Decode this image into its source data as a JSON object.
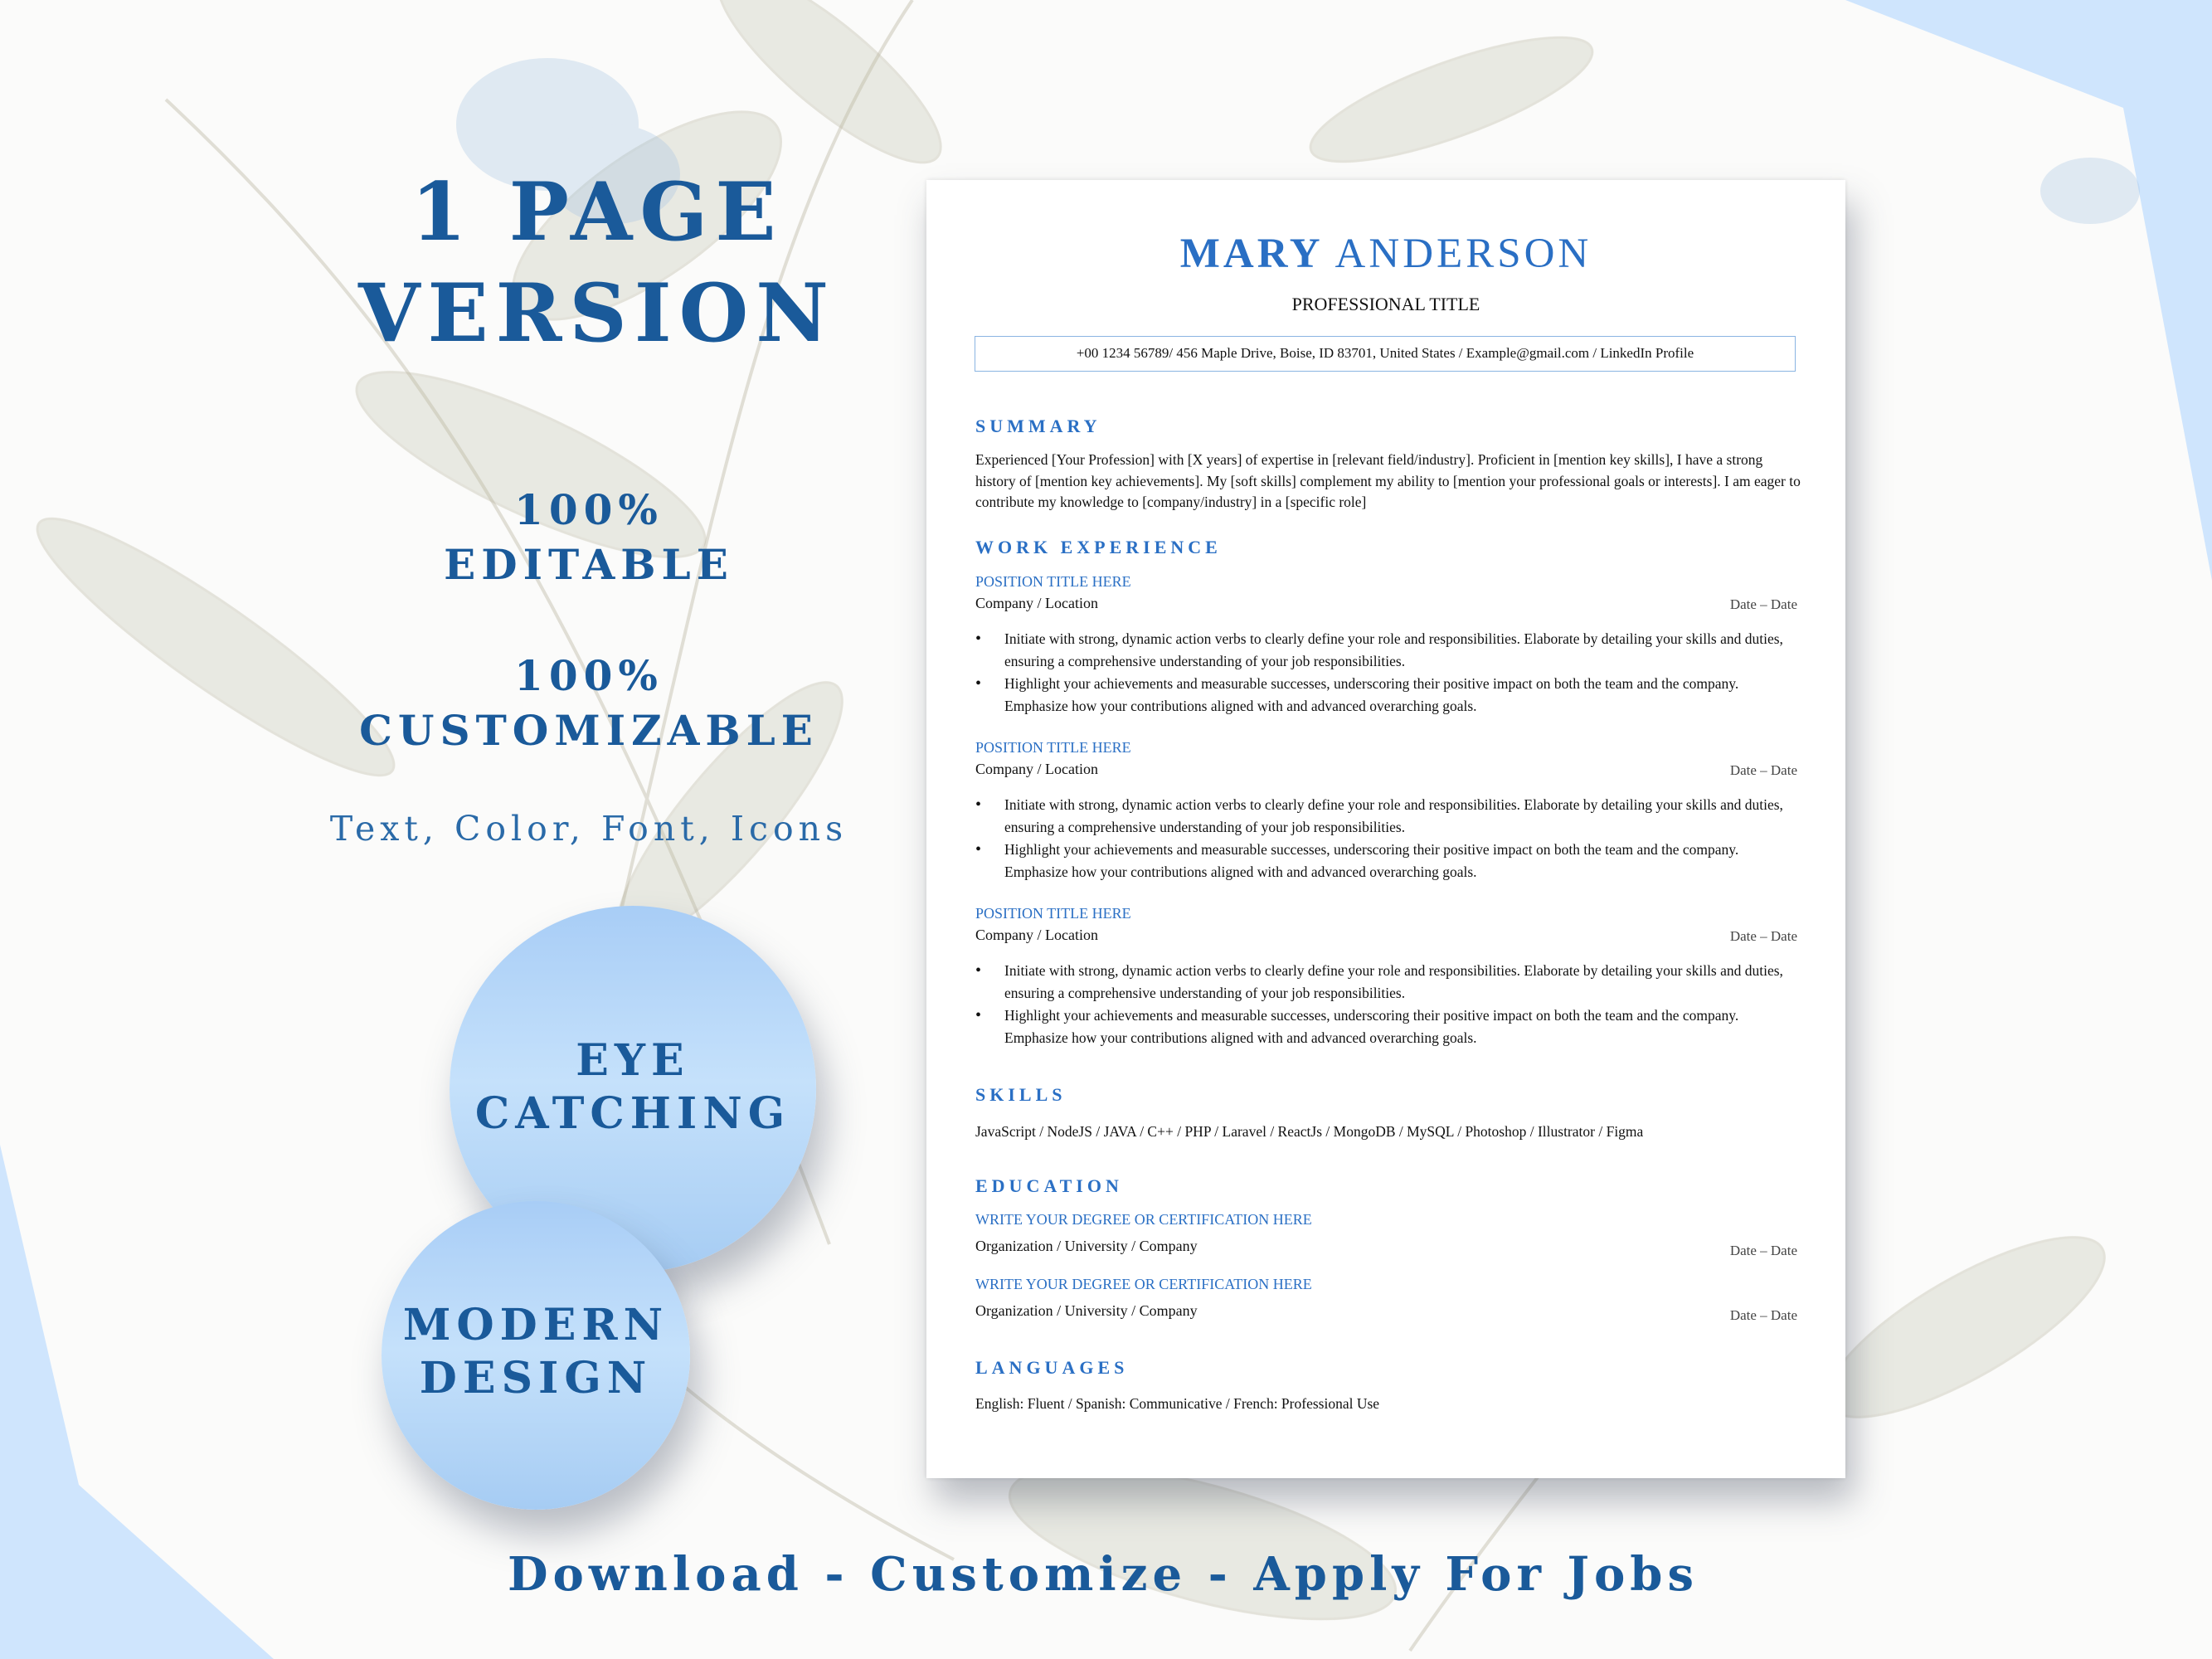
{
  "promo": {
    "heading_line1": "1 PAGE",
    "heading_line2": "VERSION",
    "feature1_line1": "100%",
    "feature1_line2": "EDITABLE",
    "feature2_line1": "100%",
    "feature2_line2": "CUSTOMIZABLE",
    "subtext": "Text, Color, Font, Icons",
    "circle1_line1": "EYE",
    "circle1_line2": "CATCHING",
    "circle2_line1": "MODERN",
    "circle2_line2": "DESIGN",
    "tagline": "Download - Customize - Apply For Jobs"
  },
  "colors": {
    "accent": "#2a6fc4",
    "promo_text": "#1a5a9a",
    "circle_fill": "#b8d8f8",
    "corner_blue": "#cfe5fd"
  },
  "resume": {
    "first_name": "MARY",
    "last_name": "ANDERSON",
    "title": "PROFESSIONAL TITLE",
    "contact": "+00 1234 56789/ 456 Maple Drive, Boise, ID 83701, United States / Example@gmail.com / LinkedIn Profile",
    "summary_heading": "SUMMARY",
    "summary_text": "Experienced [Your Profession] with [X years] of expertise in [relevant field/industry]. Proficient in [mention key skills], I have a strong history of [mention key achievements]. My [soft skills] complement my ability to [mention your professional goals or interests]. I am eager to contribute my knowledge to [company/industry] in a [specific role]",
    "work_heading": "WORK EXPERIENCE",
    "jobs": [
      {
        "position": "POSITION TITLE HERE",
        "company": "Company / Location",
        "date": "Date – Date",
        "bullets": [
          "Initiate with strong, dynamic action verbs to clearly define your role and responsibilities. Elaborate by detailing your skills and duties, ensuring a comprehensive understanding of your job responsibilities.",
          "Highlight your achievements and measurable successes, underscoring their positive impact on both the team and the company. Emphasize how your contributions aligned with and advanced overarching goals."
        ]
      },
      {
        "position": "POSITION TITLE HERE",
        "company": "Company / Location",
        "date": "Date – Date",
        "bullets": [
          "Initiate with strong, dynamic action verbs to clearly define your role and responsibilities. Elaborate by detailing your skills and duties, ensuring a comprehensive understanding of your job responsibilities.",
          "Highlight your achievements and measurable successes, underscoring their positive impact on both the team and the company. Emphasize how your contributions aligned with and advanced overarching goals."
        ]
      },
      {
        "position": "POSITION TITLE HERE",
        "company": "Company / Location",
        "date": "Date – Date",
        "bullets": [
          "Initiate with strong, dynamic action verbs to clearly define your role and responsibilities. Elaborate by detailing your skills and duties, ensuring a comprehensive understanding of your job responsibilities.",
          "Highlight your achievements and measurable successes, underscoring their positive impact on both the team and the company. Emphasize how your contributions aligned with and advanced overarching goals."
        ]
      }
    ],
    "skills_heading": "SKILLS",
    "skills_text": "JavaScript / NodeJS / JAVA / C++ / PHP / Laravel / ReactJs / MongoDB / MySQL / Photoshop / Illustrator / Figma",
    "education_heading": "EDUCATION",
    "education": [
      {
        "degree": "WRITE YOUR DEGREE OR CERTIFICATION HERE",
        "org": "Organization / University / Company",
        "date": "Date – Date"
      },
      {
        "degree": "WRITE YOUR DEGREE OR CERTIFICATION HERE",
        "org": "Organization / University / Company",
        "date": "Date – Date"
      }
    ],
    "languages_heading": "LANGUAGES",
    "languages_text": "English: Fluent / Spanish: Communicative / French: Professional Use"
  }
}
